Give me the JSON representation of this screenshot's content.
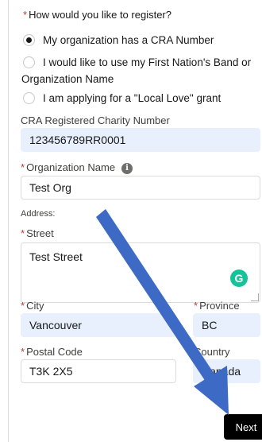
{
  "register": {
    "question": "How would you like to register?",
    "options": [
      {
        "label": "My organization has a CRA Number",
        "checked": true
      },
      {
        "label_line1": "I would like to use my First Nation's Band or",
        "label_line2": "Organization Name",
        "checked": false
      },
      {
        "label": "I am applying for a \"Local Love\" grant",
        "checked": false
      }
    ]
  },
  "cra": {
    "label": "CRA Registered Charity Number",
    "value": "123456789RR0001"
  },
  "organization": {
    "label": "Organization Name",
    "value": "Test Org"
  },
  "address": {
    "label": "Address:",
    "street_label": "Street",
    "street_value": "Test Street",
    "city_label": "City",
    "city_value": "Vancouver",
    "province_label": "Province",
    "province_value": "BC",
    "postal_label": "Postal Code",
    "postal_value": "T3K 2X5",
    "country_label": "Country",
    "country_value": "Canada"
  },
  "actions": {
    "next_label": "Next"
  },
  "icons": {
    "info": "info-icon",
    "grammarly": "grammarly-icon"
  },
  "colors": {
    "required_asterisk": "#c23934",
    "autofill_bg": "#e8f0fe",
    "arrow": "#3d6ac4",
    "next_button": "#000000"
  }
}
